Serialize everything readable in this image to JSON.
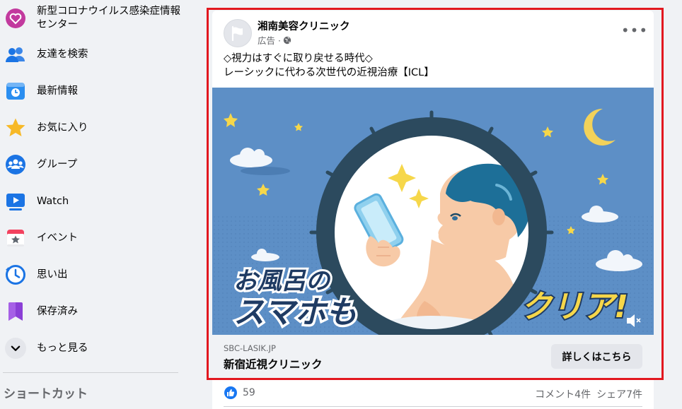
{
  "sidebar": {
    "items": [
      {
        "label": "新型コロナウイルス感染症情報センター",
        "icon": "covid-heart-icon"
      },
      {
        "label": "友達を検索",
        "icon": "friends-icon"
      },
      {
        "label": "最新情報",
        "icon": "news-feed-icon"
      },
      {
        "label": "お気に入り",
        "icon": "star-icon"
      },
      {
        "label": "グループ",
        "icon": "groups-icon"
      },
      {
        "label": "Watch",
        "icon": "watch-icon"
      },
      {
        "label": "イベント",
        "icon": "events-icon"
      },
      {
        "label": "思い出",
        "icon": "memories-icon"
      },
      {
        "label": "保存済み",
        "icon": "saved-icon"
      },
      {
        "label": "もっと見る",
        "icon": "chevron-down-icon"
      }
    ],
    "shortcuts_heading": "ショートカット"
  },
  "post": {
    "page_name": "湘南美容クリニック",
    "sponsored": "広告 ·",
    "more": "•••",
    "text_line1": "◇視力はすぐに取り戻せる時代◇",
    "text_line2": "レーシックに代わる次世代の近視治療【ICL】",
    "image": {
      "text_left_line1": "お風呂の",
      "text_left_line2": "スマホも",
      "text_right": "クリア!"
    },
    "domain": "SBC-LASIK.JP",
    "headline": "新宿近視クリニック",
    "cta": "詳しくはこちら"
  },
  "reactions": {
    "likes": "59",
    "comments": "コメント4件",
    "shares": "シェア7件"
  },
  "colors": {
    "highlight": "#e2181f",
    "image_bg": "#5d8fc6",
    "clock_ring": "#2c4a5e",
    "star": "#f6d74a",
    "like_blue": "#1877f2"
  }
}
